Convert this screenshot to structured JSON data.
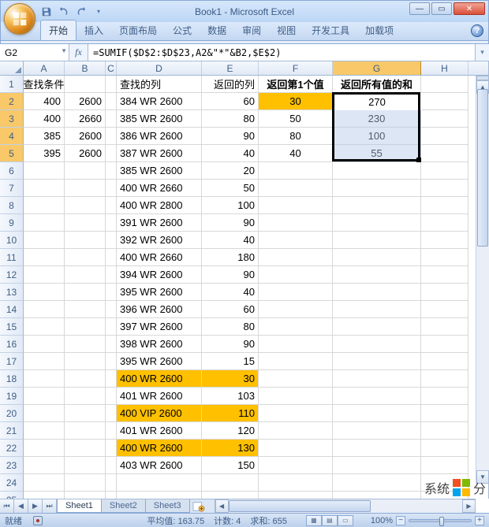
{
  "title": "Book1 - Microsoft Excel",
  "ribbon": {
    "tabs": [
      "开始",
      "插入",
      "页面布局",
      "公式",
      "数据",
      "审阅",
      "视图",
      "开发工具",
      "加载项"
    ],
    "active_index": 0
  },
  "name_box": "G2",
  "fx_label": "fx",
  "formula": "=SUMIF($D$2:$D$23,A2&\"*\"&B2,$E$2)",
  "columns": [
    {
      "letter": "A",
      "width": 52
    },
    {
      "letter": "B",
      "width": 52
    },
    {
      "letter": "C",
      "width": 14
    },
    {
      "letter": "D",
      "width": 108
    },
    {
      "letter": "E",
      "width": 72
    },
    {
      "letter": "F",
      "width": 94
    },
    {
      "letter": "G",
      "width": 112
    },
    {
      "letter": "H",
      "width": 60
    }
  ],
  "selected_col_index": 6,
  "row_count": 25,
  "selected_rows": [
    2,
    3,
    4,
    5
  ],
  "headers_row": {
    "AB": "查找条件",
    "D": "查找的列",
    "E": "返回的列",
    "F": "返回第1个值",
    "G": "返回所有值的和"
  },
  "data": {
    "A": {
      "2": "400",
      "3": "400",
      "4": "385",
      "5": "395"
    },
    "B": {
      "2": "2600",
      "3": "2660",
      "4": "2600",
      "5": "2600"
    },
    "D": {
      "2": "384 WR 2600",
      "3": "385 WR 2600",
      "4": "386 WR 2600",
      "5": "387 WR 2600",
      "6": "385 WR 2600",
      "7": "400 WR 2660",
      "8": "400 WR 2800",
      "9": "391 WR 2600",
      "10": "392 WR 2600",
      "11": "400 WR 2660",
      "12": "394 WR 2600",
      "13": "395 WR 2600",
      "14": "396 WR 2600",
      "15": "397 WR 2600",
      "16": "398 WR 2600",
      "17": "395 WR 2600",
      "18": "400 WR 2600",
      "19": "401 WR 2600",
      "20": "400 VIP 2600",
      "21": "401 WR 2600",
      "22": "400 WR 2600",
      "23": "403 WR 2600"
    },
    "E": {
      "2": "60",
      "3": "80",
      "4": "90",
      "5": "40",
      "6": "20",
      "7": "50",
      "8": "100",
      "9": "90",
      "10": "40",
      "11": "180",
      "12": "90",
      "13": "40",
      "14": "60",
      "15": "80",
      "16": "90",
      "17": "15",
      "18": "30",
      "19": "103",
      "20": "110",
      "21": "120",
      "22": "130",
      "23": "150"
    },
    "F": {
      "2": "30",
      "3": "50",
      "4": "80",
      "5": "40"
    },
    "G": {
      "2": "270",
      "3": "230",
      "4": "100",
      "5": "55"
    }
  },
  "highlights": {
    "orange_DE_rows": [
      18,
      20,
      22
    ],
    "orange_F_rows": [
      2
    ]
  },
  "sheets": {
    "list": [
      "Sheet1",
      "Sheet2",
      "Sheet3"
    ],
    "active_index": 0
  },
  "status": {
    "ready": "就绪",
    "macro_tooltip": "录制宏",
    "avg_label": "平均值:",
    "avg_value": "163.75",
    "count_label": "计数:",
    "count_value": "4",
    "sum_label": "求和:",
    "sum_value": "655",
    "zoom": "100%"
  },
  "win": {
    "min": "—",
    "max": "▭",
    "close": "✕"
  },
  "watermark": {
    "text_a": "系统",
    "text_b": "分"
  }
}
